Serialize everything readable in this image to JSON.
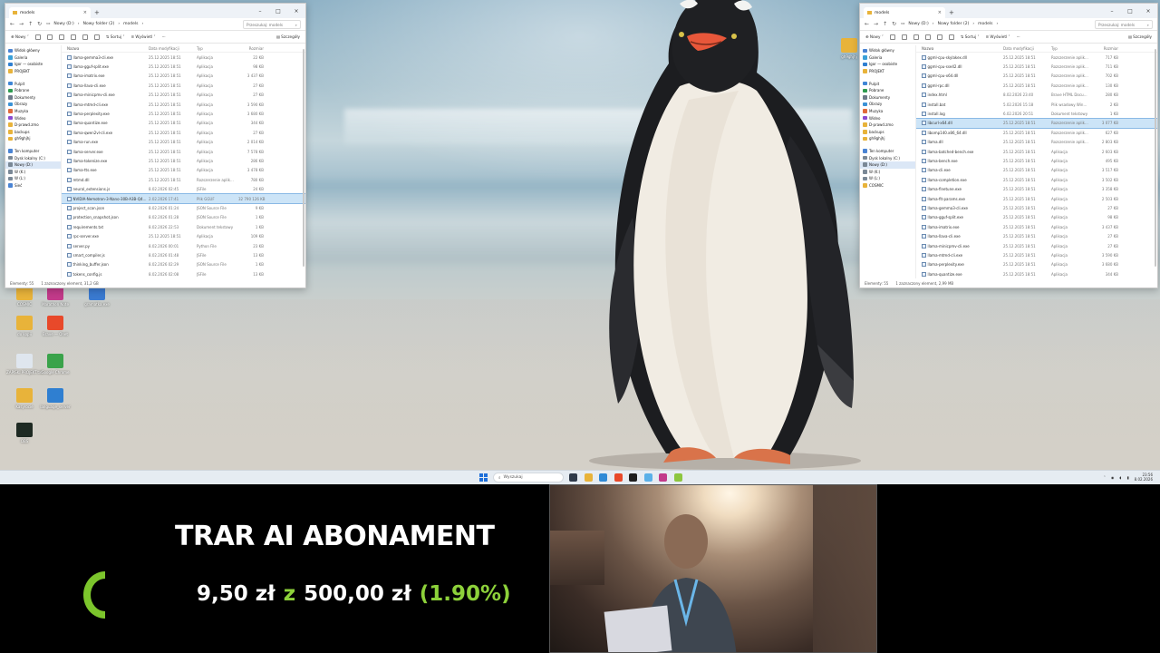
{
  "left_window": {
    "tab_title": "models",
    "breadcrumbs": [
      "Nowy (D:)",
      "Nowy folder (2)",
      "models"
    ],
    "search_placeholder": "Przeszukaj: models",
    "cmd": {
      "new": "Nowy",
      "sort": "Sortuj",
      "view": "Wyświetl",
      "more": "···",
      "details": "Szczegóły"
    },
    "nav_items": [
      {
        "label": "Widok główny",
        "color": "#4a84d4"
      },
      {
        "label": "Galeria",
        "color": "#3aa0d8"
      },
      {
        "label": "Igor — osobiste",
        "color": "#2f7fd1"
      },
      {
        "label": "PROJEKT",
        "color": "#e8b33a"
      },
      {
        "label": "Pulpit",
        "color": "#3f86d6",
        "gap": true
      },
      {
        "label": "Pobrane",
        "color": "#2e9b4f"
      },
      {
        "label": "Dokumenty",
        "color": "#6d7a88"
      },
      {
        "label": "Obrazy",
        "color": "#3a92d6"
      },
      {
        "label": "Muzyka",
        "color": "#e06a3a"
      },
      {
        "label": "Wideo",
        "color": "#8a4ad0"
      },
      {
        "label": "D-prawd.zmo",
        "color": "#e8b33a"
      },
      {
        "label": "backups",
        "color": "#e8b33a"
      },
      {
        "label": "gh9ghjhj",
        "color": "#e8b33a"
      },
      {
        "label": "Ten komputer",
        "color": "#4a84d4",
        "gap": true
      },
      {
        "label": "Dysk lokalny (C:)",
        "color": "#7a8896"
      },
      {
        "label": "Nowy (D:)",
        "color": "#7a8896",
        "sel": true
      },
      {
        "label": "W (K:)",
        "color": "#7a8896"
      },
      {
        "label": "W (L:)",
        "color": "#7a8896"
      },
      {
        "label": "Sieć",
        "color": "#4a84d4"
      }
    ],
    "columns": [
      "Nazwa",
      "Data modyfikacji",
      "Typ",
      "Rozmiar"
    ],
    "files": [
      [
        "llama-gemma3-cli.exe",
        "25.12.2025 18:51",
        "Aplikacja",
        "22 KB"
      ],
      [
        "llama-gguf-split.exe",
        "25.12.2025 18:51",
        "Aplikacja",
        "98 KB"
      ],
      [
        "llama-imatrix.exe",
        "25.12.2025 18:51",
        "Aplikacja",
        "3 437 KB"
      ],
      [
        "llama-llava-cli.exe",
        "25.12.2025 18:51",
        "Aplikacja",
        "27 KB"
      ],
      [
        "llama-minicpmv-cli.exe",
        "25.12.2025 18:51",
        "Aplikacja",
        "27 KB"
      ],
      [
        "llama-mtmd-cli.exe",
        "25.12.2025 18:51",
        "Aplikacja",
        "3 590 KB"
      ],
      [
        "llama-perplexity.exe",
        "25.12.2025 18:51",
        "Aplikacja",
        "3 680 KB"
      ],
      [
        "llama-quantize.exe",
        "25.12.2025 18:51",
        "Aplikacja",
        "344 KB"
      ],
      [
        "llama-qwen2vl-cli.exe",
        "25.12.2025 18:51",
        "Aplikacja",
        "27 KB"
      ],
      [
        "llama-run.exe",
        "25.12.2025 18:51",
        "Aplikacja",
        "2 014 KB"
      ],
      [
        "llama-server.exe",
        "25.12.2025 18:51",
        "Aplikacja",
        "7 578 KB"
      ],
      [
        "llama-tokenize.exe",
        "25.12.2025 18:51",
        "Aplikacja",
        "286 KB"
      ],
      [
        "llama-tts.exe",
        "25.12.2025 18:51",
        "Aplikacja",
        "3 478 KB"
      ],
      [
        "mtmd.dll",
        "25.12.2025 18:51",
        "Rozszerzenie aplik…",
        "780 KB"
      ],
      [
        "neural_extensions.js",
        "8.02.2026 02:45",
        "JSFile",
        "24 KB"
      ],
      [
        "NVIDIA-Nemotron-3-Nano-30B-A3B-Q4…",
        "2.02.2026 17:41",
        "Plik GGUF",
        "32 790 126 KB"
      ],
      [
        "project_scan.json",
        "8.02.2026 01:24",
        "JSON Source File",
        "9 KB"
      ],
      [
        "protection_snapshot.json",
        "8.02.2026 01:28",
        "JSON Source File",
        "1 KB"
      ],
      [
        "requirements.txt",
        "8.02.2026 22:53",
        "Dokument tekstowy",
        "1 KB"
      ],
      [
        "rpc-server.exe",
        "25.12.2025 18:51",
        "Aplikacja",
        "109 KB"
      ],
      [
        "server.py",
        "8.02.2026 00:01",
        "Python File",
        "23 KB"
      ],
      [
        "smart_compiler.js",
        "8.02.2026 01:48",
        "JSFile",
        "13 KB"
      ],
      [
        "thinking_buffer.json",
        "8.02.2026 02:29",
        "JSON Source File",
        "1 KB"
      ],
      [
        "tokens_config.js",
        "8.02.2026 02:08",
        "JSFile",
        "13 KB"
      ]
    ],
    "selected_index": 15,
    "status": {
      "count": "Elementy: 55",
      "selection": "1 zaznaczony element, 31,2 GB"
    }
  },
  "right_window": {
    "tab_title": "models",
    "breadcrumbs": [
      "Nowy (D:)",
      "Nowy folder (2)",
      "models"
    ],
    "search_placeholder": "Przeszukaj: models",
    "cmd": {
      "new": "Nowy",
      "sort": "Sortuj",
      "view": "Wyświetl",
      "more": "···",
      "details": "Szczegóły"
    },
    "nav_items": [
      {
        "label": "Widok główny",
        "color": "#4a84d4"
      },
      {
        "label": "Galeria",
        "color": "#3aa0d8"
      },
      {
        "label": "Igor — osobiste",
        "color": "#2f7fd1"
      },
      {
        "label": "PROJEKT",
        "color": "#e8b33a"
      },
      {
        "label": "Pulpit",
        "color": "#3f86d6",
        "gap": true
      },
      {
        "label": "Pobrane",
        "color": "#2e9b4f"
      },
      {
        "label": "Dokumenty",
        "color": "#6d7a88"
      },
      {
        "label": "Obrazy",
        "color": "#3a92d6"
      },
      {
        "label": "Muzyka",
        "color": "#e06a3a"
      },
      {
        "label": "Wideo",
        "color": "#8a4ad0"
      },
      {
        "label": "D-prawd.zmo",
        "color": "#e8b33a"
      },
      {
        "label": "backups",
        "color": "#e8b33a"
      },
      {
        "label": "gh9ghjhj",
        "color": "#e8b33a"
      },
      {
        "label": "Ten komputer",
        "color": "#4a84d4",
        "gap": true
      },
      {
        "label": "Dysk lokalny (C:)",
        "color": "#7a8896"
      },
      {
        "label": "Nowy (D:)",
        "color": "#7a8896",
        "sel": true
      },
      {
        "label": "W (K:)",
        "color": "#7a8896"
      },
      {
        "label": "W (L:)",
        "color": "#7a8896"
      },
      {
        "label": "COSMIC",
        "color": "#e8b33a"
      }
    ],
    "columns": [
      "Nazwa",
      "Data modyfikacji",
      "Typ",
      "Rozmiar"
    ],
    "files": [
      [
        "ggml-cpu-skylakex.dll",
        "25.12.2025 18:51",
        "Rozszerzenie aplik…",
        "717 KB"
      ],
      [
        "ggml-cpu-sse42.dll",
        "25.12.2025 18:51",
        "Rozszerzenie aplik…",
        "711 KB"
      ],
      [
        "ggml-cpu-x64.dll",
        "25.12.2025 18:51",
        "Rozszerzenie aplik…",
        "702 KB"
      ],
      [
        "ggml-rpc.dll",
        "25.12.2025 18:51",
        "Rozszerzenie aplik…",
        "130 KB"
      ],
      [
        "index.html",
        "8.02.2026 23:40",
        "Brave HTML Docu…",
        "280 KB"
      ],
      [
        "install.bat",
        "5.02.2026 15:18",
        "Plik wsadowy Win…",
        "2 KB"
      ],
      [
        "install.log",
        "6.02.2026 20:51",
        "Dokument tekstowy",
        "1 KB"
      ],
      [
        "libcurl-x64.dll",
        "25.12.2025 18:51",
        "Rozszerzenie aplik…",
        "3 077 KB"
      ],
      [
        "libomp140.x86_64.dll",
        "25.12.2025 18:51",
        "Rozszerzenie aplik…",
        "627 KB"
      ],
      [
        "llama.dll",
        "25.12.2025 18:51",
        "Rozszerzenie aplik…",
        "2 803 KB"
      ],
      [
        "llama-batched-bench.exe",
        "25.12.2025 18:51",
        "Aplikacja",
        "2 603 KB"
      ],
      [
        "llama-bench.exe",
        "25.12.2025 18:51",
        "Aplikacja",
        "495 KB"
      ],
      [
        "llama-cli.exe",
        "25.12.2025 18:51",
        "Aplikacja",
        "3 517 KB"
      ],
      [
        "llama-completion.exe",
        "25.12.2025 18:51",
        "Aplikacja",
        "3 502 KB"
      ],
      [
        "llama-finetune.exe",
        "25.12.2025 18:51",
        "Aplikacja",
        "3 358 KB"
      ],
      [
        "llama-fit-params.exe",
        "25.12.2025 18:51",
        "Aplikacja",
        "2 503 KB"
      ],
      [
        "llama-gemma3-cli.exe",
        "25.12.2025 18:51",
        "Aplikacja",
        "27 KB"
      ],
      [
        "llama-gguf-split.exe",
        "25.12.2025 18:51",
        "Aplikacja",
        "98 KB"
      ],
      [
        "llama-imatrix.exe",
        "25.12.2025 18:51",
        "Aplikacja",
        "3 437 KB"
      ],
      [
        "llama-llava-cli.exe",
        "25.12.2025 18:51",
        "Aplikacja",
        "27 KB"
      ],
      [
        "llama-minicpmv-cli.exe",
        "25.12.2025 18:51",
        "Aplikacja",
        "27 KB"
      ],
      [
        "llama-mtmd-cli.exe",
        "25.12.2025 18:51",
        "Aplikacja",
        "3 590 KB"
      ],
      [
        "llama-perplexity.exe",
        "25.12.2025 18:51",
        "Aplikacja",
        "3 680 KB"
      ],
      [
        "llama-quantize.exe",
        "25.12.2025 18:51",
        "Aplikacja",
        "344 KB"
      ]
    ],
    "selected_index": 7,
    "status": {
      "count": "Elementy: 55",
      "selection": "1 zaznaczony element, 2,99 MB"
    }
  },
  "desktop_icons": [
    {
      "label": "COSMIC",
      "color": "#e8b33a"
    },
    {
      "label": "Marathon Note",
      "color": "#c23a8a"
    },
    {
      "label": "gramatka.exe",
      "color": "#3a7ad0"
    },
    {
      "label": "do kopii",
      "color": "#e8b33a"
    },
    {
      "label": "Brave — Onet",
      "color": "#e8492a"
    },
    {
      "label": "ZAPISKI PROJEKT.txt",
      "color": "#dfe6ee"
    },
    {
      "label": "Google Chrome",
      "color": "#3aa34a"
    },
    {
      "label": "Kasyrocie",
      "color": "#e8b33a"
    },
    {
      "label": "language_server",
      "color": "#2f7fd1"
    },
    {
      "label": "OBS",
      "color": "#1e2a23"
    },
    {
      "label": "gh9ghjhj",
      "color": "#e8b33a"
    }
  ],
  "taskbar": {
    "search_placeholder": "Wyszukaj",
    "apps": [
      {
        "name": "terminal",
        "color": "#2f3a4a"
      },
      {
        "name": "file-explorer",
        "color": "#e8b33a"
      },
      {
        "name": "edge",
        "color": "#2f8ad6"
      },
      {
        "name": "brave",
        "color": "#e8492a"
      },
      {
        "name": "obs",
        "color": "#1e1e1e"
      },
      {
        "name": "notepad",
        "color": "#5ab0e8"
      },
      {
        "name": "app-pink",
        "color": "#c23a8a"
      },
      {
        "name": "app-green",
        "color": "#8dc63f"
      }
    ],
    "time": "23:56",
    "date": "8.02.2026"
  },
  "overlay": {
    "title": "TRAR AI ABONAMENT",
    "raised": "9,50 zł",
    "connector": "z",
    "goal": "500,00 zł",
    "percent": "(1.90%)",
    "progress_fraction": 0.019
  },
  "colors": {
    "accent_green": "#8dd13a",
    "selection_blue": "#cce4f7"
  }
}
